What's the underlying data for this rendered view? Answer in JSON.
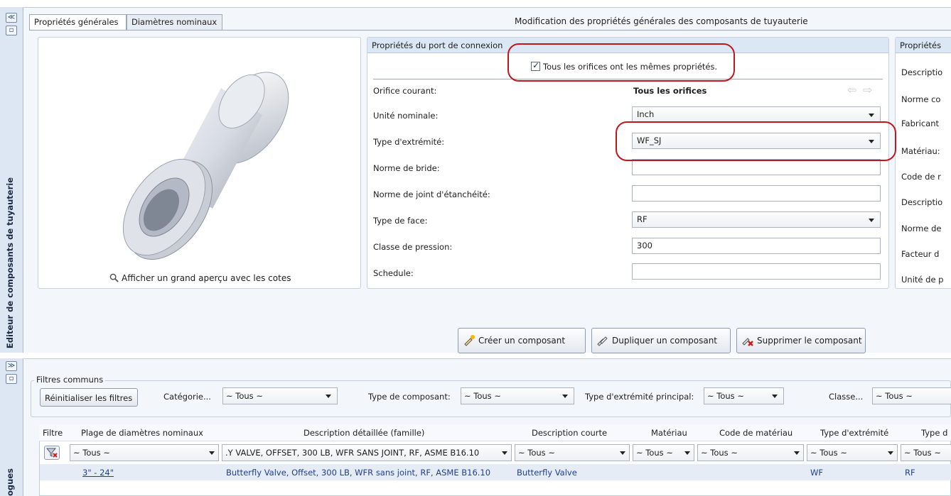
{
  "sidebar": {
    "top_label": "Editeur de composants de tuyauterie",
    "bottom_label": "ogues"
  },
  "tabs": [
    {
      "label": "Propriétés générales",
      "active": true
    },
    {
      "label": "Diamètres nominaux",
      "active": false
    }
  ],
  "editor_title": "Modification des propriétés générales des composants de tuyauterie",
  "preview": {
    "link_label": "Afficher un grand aperçu avec les cotes"
  },
  "port_props": {
    "header": "Propriétés du port de connexion",
    "same_props_checkbox": "Tous les orifices ont les mêmes propriétés.",
    "same_props_checked": true,
    "fields": [
      {
        "label": "Orifice courant:",
        "value": "Tous les orifices",
        "kind": "readonly"
      },
      {
        "label": "Unité nominale:",
        "value": "Inch",
        "kind": "combo"
      },
      {
        "label": "Type d'extrémité:",
        "value": "WF_SJ",
        "kind": "combo"
      },
      {
        "label": "Norme de bride:",
        "value": "",
        "kind": "text"
      },
      {
        "label": "Norme de joint d'étanchéité:",
        "value": "",
        "kind": "text"
      },
      {
        "label": "Type de face:",
        "value": "RF",
        "kind": "combo"
      },
      {
        "label": "Classe de pression:",
        "value": "300",
        "kind": "text"
      },
      {
        "label": "Schedule:",
        "value": "",
        "kind": "text"
      }
    ]
  },
  "general_props": {
    "header": "Propriétés",
    "labels": [
      "Descriptio",
      "Norme co",
      "Fabricant",
      "Matériau:",
      "Code de r",
      "Descriptio",
      "Norme de",
      "Facteur d",
      "Unité de p"
    ]
  },
  "actions": {
    "create": "Créer un composant",
    "duplicate": "Dupliquer un composant",
    "delete": "Supprimer le composant"
  },
  "filters": {
    "legend": "Filtres communs",
    "reset_button": "Réinitialiser les filtres",
    "category_label": "Catégorie...",
    "category_value": "~ Tous ~",
    "component_type_label": "Type de composant:",
    "component_type_value": "~ Tous ~",
    "end_type_label": "Type d'extrémité principal:",
    "end_type_value": "~ Tous ~",
    "class_label": "Classe...",
    "class_value": "~ Tous ~"
  },
  "grid": {
    "columns": [
      "Filtre",
      "Plage de diamètres nominaux",
      "Description détaillée (famille)",
      "Description courte",
      "Matériau",
      "Code de matériau",
      "Type d'extrémité",
      "Type d"
    ],
    "filter_row": [
      "",
      "~ Tous ~",
      ".Y VALVE, OFFSET, 300 LB, WFR SANS JOINT, RF, ASME B16.10",
      "~ Tous ~",
      "~ Tous ~",
      "~ Tous ~",
      "~ Tous ~",
      "~ Tous ~"
    ],
    "rows": [
      [
        "",
        "3\" - 24\"",
        "Butterfly Valve, Offset, 300 LB, WFR sans joint, RF, ASME B16.10",
        "Butterfly Valve",
        "",
        "",
        "WF",
        "RF"
      ]
    ]
  }
}
